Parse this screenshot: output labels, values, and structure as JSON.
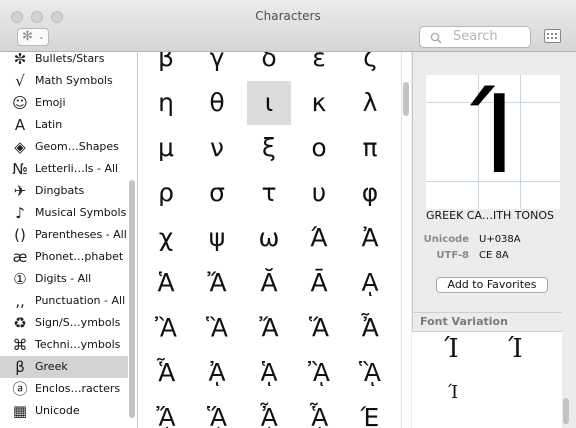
{
  "window": {
    "title": "Characters"
  },
  "toolbar": {
    "gear_glyph": "✻",
    "chevron_glyph": "⌄",
    "search_placeholder": "Search"
  },
  "sidebar": {
    "items": [
      {
        "icon": "✼",
        "label": "Bullets/Stars",
        "selected": false
      },
      {
        "icon": "√",
        "label": "Math Symbols",
        "selected": false
      },
      {
        "icon": "☺",
        "label": "Emoji",
        "selected": false
      },
      {
        "icon": "A",
        "label": "Latin",
        "selected": false
      },
      {
        "icon": "◈",
        "label": "Geom…Shapes",
        "selected": false
      },
      {
        "icon": "№",
        "label": "Letterli…ls - All",
        "selected": false
      },
      {
        "icon": "✈",
        "label": "Dingbats",
        "selected": false
      },
      {
        "icon": "♪",
        "label": "Musical Symbols",
        "selected": false
      },
      {
        "icon": "()",
        "label": "Parentheses - All",
        "selected": false
      },
      {
        "icon": "æ",
        "label": "Phonet…phabet",
        "selected": false
      },
      {
        "icon": "①",
        "label": "Digits - All",
        "selected": false
      },
      {
        "icon": "‚,",
        "label": "Punctuation - All",
        "selected": false
      },
      {
        "icon": "♻",
        "label": "Sign/S…ymbols",
        "selected": false
      },
      {
        "icon": "⌘",
        "label": "Techni…ymbols",
        "selected": false
      },
      {
        "icon": "β",
        "label": "Greek",
        "selected": true
      },
      {
        "icon": "ⓐ",
        "label": "Enclos…racters",
        "selected": false
      },
      {
        "icon": "▦",
        "label": "Unicode",
        "selected": false
      }
    ]
  },
  "grid": {
    "rows": [
      [
        "β",
        "γ",
        "δ",
        "ε",
        "ζ"
      ],
      [
        "η",
        "θ",
        "ι",
        "κ",
        "λ"
      ],
      [
        "μ",
        "ν",
        "ξ",
        "ο",
        "π"
      ],
      [
        "ρ",
        "σ",
        "τ",
        "υ",
        "φ"
      ],
      [
        "χ",
        "ψ",
        "ω",
        "Ά",
        "Ἀ"
      ],
      [
        "Ἁ",
        "Ἄ",
        "Ᾰ",
        "Ᾱ",
        "ᾼ"
      ],
      [
        "Ἂ",
        "Ἃ",
        "Ἄ",
        "Ἅ",
        "Ἆ"
      ],
      [
        "Ἇ",
        "ᾈ",
        "ᾉ",
        "ᾊ",
        "ᾋ"
      ],
      [
        "ᾌ",
        "ᾍ",
        "ᾎ",
        "ᾏ",
        "Έ"
      ]
    ],
    "selected": {
      "row": 1,
      "col": 2
    }
  },
  "detail": {
    "preview_glyph": "Ί",
    "char_name": "GREEK CA…ITH TONOS",
    "unicode_label": "Unicode",
    "unicode_value": "U+038A",
    "utf8_label": "UTF-8",
    "utf8_value": "CE 8A",
    "favorites_button": "Add to Favorites",
    "font_variation_header": "Font Variation",
    "font_variations": [
      "Ί",
      "Ί",
      "Ί"
    ]
  }
}
